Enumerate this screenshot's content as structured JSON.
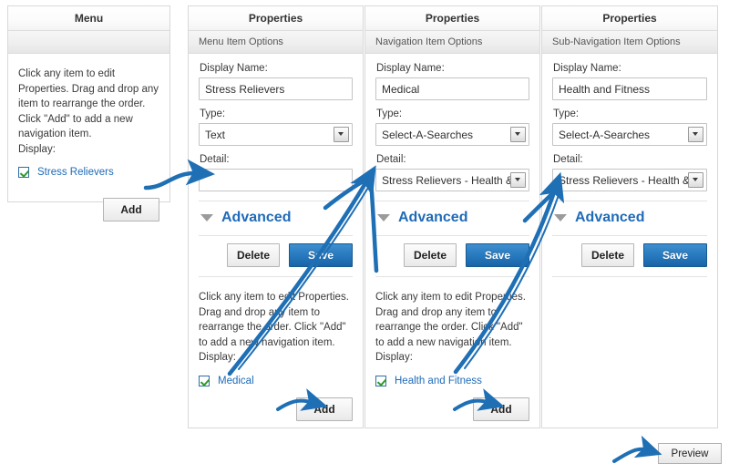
{
  "menu_panel": {
    "title": "Menu",
    "subheader": "",
    "help_text": "Click any item to edit Properties. Drag and drop any item to rearrange the order. Click \"Add\" to add a new navigation item.",
    "display_label": "Display:",
    "items": [
      {
        "label": "Stress Relievers",
        "checked": true
      }
    ],
    "add_label": "Add"
  },
  "properties_panels": [
    {
      "title": "Properties",
      "subheader": "Menu Item Options",
      "display_name_label": "Display Name:",
      "display_name_value": "Stress Relievers",
      "type_label": "Type:",
      "type_value": "Text",
      "detail_label": "Detail:",
      "detail_value": "",
      "detail_is_select": false,
      "advanced_label": "Advanced",
      "delete_label": "Delete",
      "save_label": "Save",
      "help_text": "Click any item to edit Properties. Drag and drop any item to rearrange the order. Click \"Add\" to add a new navigation item.",
      "display_label": "Display:",
      "items": [
        {
          "label": "Medical",
          "checked": true
        }
      ],
      "add_label": "Add",
      "has_footer": true
    },
    {
      "title": "Properties",
      "subheader": "Navigation Item Options",
      "display_name_label": "Display Name:",
      "display_name_value": "Medical",
      "type_label": "Type:",
      "type_value": "Select-A-Searches",
      "detail_label": "Detail:",
      "detail_value": "Stress Relievers - Health & F",
      "detail_is_select": true,
      "advanced_label": "Advanced",
      "delete_label": "Delete",
      "save_label": "Save",
      "help_text": "Click any item to edit Properties. Drag and drop any item to rearrange the order. Click \"Add\" to add a new navigation item.",
      "display_label": "Display:",
      "items": [
        {
          "label": "Health and Fitness",
          "checked": true
        }
      ],
      "add_label": "Add",
      "has_footer": true
    },
    {
      "title": "Properties",
      "subheader": "Sub-Navigation Item Options",
      "display_name_label": "Display Name:",
      "display_name_value": "Health and Fitness",
      "type_label": "Type:",
      "type_value": "Select-A-Searches",
      "detail_label": "Detail:",
      "detail_value": "Stress Relievers - Health & F",
      "detail_is_select": true,
      "advanced_label": "Advanced",
      "delete_label": "Delete",
      "save_label": "Save",
      "help_text": "",
      "display_label": "",
      "items": [],
      "add_label": "",
      "has_footer": false
    }
  ],
  "preview": {
    "label": "Preview"
  },
  "colors": {
    "accent_blue": "#1f6bb8",
    "annotation_blue": "#1f6fb5",
    "check_green": "#2e9b2e",
    "panel_border": "#d8d8d8"
  },
  "icons": {
    "chevron_down": "chevron-down-icon",
    "select_arrow": "dropdown-arrow-icon",
    "checkbox": "checkbox-checked-icon"
  }
}
